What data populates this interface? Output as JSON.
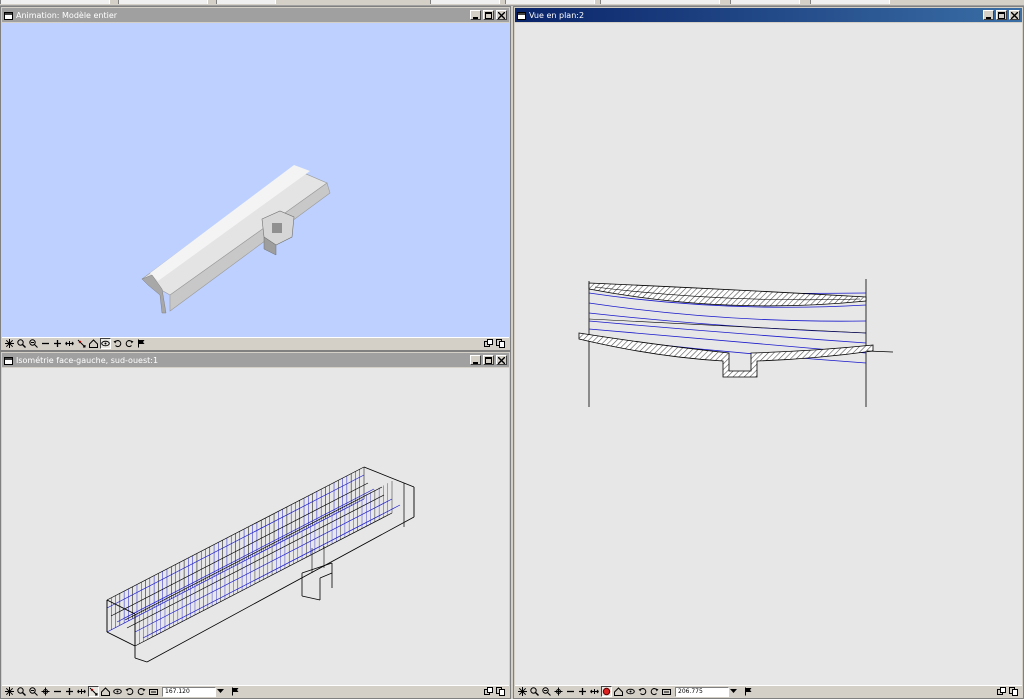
{
  "windows": {
    "animation": {
      "title": "Animation: Modèle entier",
      "background": "#bdd0ff",
      "active": false
    },
    "isometric": {
      "title": "Isométrie face-gauche, sud-ouest:1",
      "background": "#e7e7e7",
      "active": false,
      "zoom_value": "167.120"
    },
    "plan": {
      "title": "Vue en plan:2",
      "background": "#e7e7e7",
      "active": true,
      "zoom_value": "206.775"
    }
  },
  "icons": {
    "window_menu": "window-menu-icon",
    "minimize": "minimize-icon",
    "maximize": "maximize-icon",
    "close": "close-icon",
    "toolbar": [
      "select-all-icon",
      "zoom-icon",
      "zoom-window-icon",
      "pan-icon",
      "zoom-out-icon",
      "zoom-in-icon",
      "move-icon",
      "orbit-icon",
      "home-view-icon",
      "rotate-icon",
      "undo-view-icon",
      "redo-view-icon",
      "zoom-dropdown-icon",
      "flag-icon"
    ],
    "window_controls_bottom": [
      "tile-icon",
      "cascade-icon"
    ]
  },
  "colors": {
    "model_outline": "#000000",
    "wire_blue": "#1a1acc",
    "hatch": "#555555"
  }
}
